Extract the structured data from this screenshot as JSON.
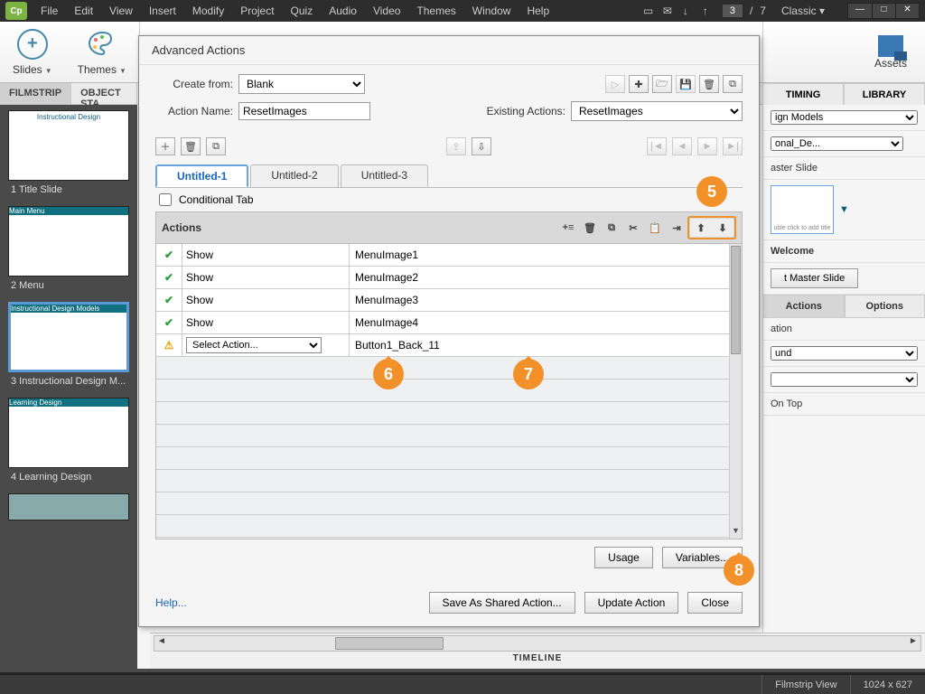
{
  "app": {
    "logo": "Cp",
    "workspace": "Classic"
  },
  "menus": [
    "File",
    "Edit",
    "View",
    "Insert",
    "Modify",
    "Project",
    "Quiz",
    "Audio",
    "Video",
    "Themes",
    "Window",
    "Help"
  ],
  "paging": {
    "current": "3",
    "sep": "/",
    "total": "7"
  },
  "toolbar": {
    "slides": "Slides",
    "themes": "Themes",
    "assets": "Assets"
  },
  "subtabs": {
    "filmstrip": "FILMSTRIP",
    "objstate": "OBJECT STA"
  },
  "filmstrip": [
    {
      "label": "1 Title Slide",
      "caption": "Instructional Design"
    },
    {
      "label": "2 Menu",
      "caption": "Main Menu"
    },
    {
      "label": "3 Instructional Design M...",
      "caption": "Instructional Design Models"
    },
    {
      "label": "4 Learning Design",
      "caption": "Learning Design"
    }
  ],
  "rightpanel": {
    "tabs": {
      "timing": "TIMING",
      "library": "LIBRARY"
    },
    "models_select": "ign Models",
    "de_select": "onal_De...",
    "master_label": "aster Slide",
    "thumb_caption": "uble click to add title",
    "welcome": "Welcome",
    "reset_master": "t Master Slide",
    "actions_tab": "Actions",
    "options_tab": "Options",
    "ation": "ation",
    "und": "und",
    "ontop": "On Top"
  },
  "dialog": {
    "title": "Advanced Actions",
    "create_from_lbl": "Create from:",
    "create_from_val": "Blank",
    "action_name_lbl": "Action Name:",
    "action_name_val": "ResetImages",
    "existing_lbl": "Existing Actions:",
    "existing_val": "ResetImages",
    "dec_tabs": [
      "Untitled-1",
      "Untitled-2",
      "Untitled-3"
    ],
    "conditional": "Conditional Tab",
    "actions_hdr": "Actions",
    "rows": [
      {
        "status": "ok",
        "action": "Show",
        "target": "MenuImage1"
      },
      {
        "status": "ok",
        "action": "Show",
        "target": "MenuImage2"
      },
      {
        "status": "ok",
        "action": "Show",
        "target": "MenuImage3"
      },
      {
        "status": "ok",
        "action": "Show",
        "target": "MenuImage4"
      },
      {
        "status": "warn",
        "action": "Select Action...",
        "target": "Button1_Back_11"
      }
    ],
    "usage_btn": "Usage",
    "variables_btn": "Variables...",
    "help": "Help...",
    "save_shared": "Save As Shared Action...",
    "update": "Update Action",
    "close": "Close"
  },
  "timeline": {
    "label": "TIMELINE"
  },
  "status": {
    "view": "Filmstrip View",
    "dims": "1024 x 627"
  },
  "callouts": {
    "c5": "5",
    "c6": "6",
    "c7": "7",
    "c8": "8"
  }
}
